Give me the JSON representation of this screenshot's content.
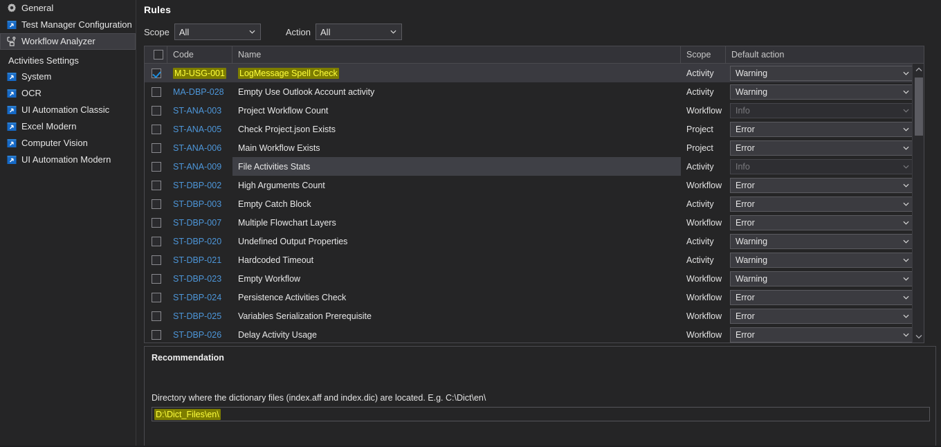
{
  "sidebar": {
    "items": [
      {
        "label": "General",
        "icon": "gear-icon",
        "selected": false,
        "section": false
      },
      {
        "label": "Test Manager Configuration",
        "icon": "package-icon",
        "selected": false,
        "section": false
      },
      {
        "label": "Workflow Analyzer",
        "icon": "workflow-analyzer-icon",
        "selected": true,
        "section": false
      },
      {
        "label": "Activities Settings",
        "icon": "",
        "selected": false,
        "section": true
      },
      {
        "label": "System",
        "icon": "package-icon",
        "selected": false,
        "section": false
      },
      {
        "label": "OCR",
        "icon": "package-icon",
        "selected": false,
        "section": false
      },
      {
        "label": "UI Automation Classic",
        "icon": "package-icon",
        "selected": false,
        "section": false
      },
      {
        "label": "Excel Modern",
        "icon": "package-icon",
        "selected": false,
        "section": false
      },
      {
        "label": "Computer Vision",
        "icon": "package-icon",
        "selected": false,
        "section": false
      },
      {
        "label": "UI Automation Modern",
        "icon": "package-icon",
        "selected": false,
        "section": false
      }
    ]
  },
  "main": {
    "title": "Rules",
    "filters": {
      "scope_label": "Scope",
      "scope_value": "All",
      "action_label": "Action",
      "action_value": "All"
    },
    "table": {
      "headers": {
        "check": "",
        "code": "Code",
        "name": "Name",
        "scope": "Scope",
        "action": "Default action"
      },
      "rows": [
        {
          "checked": true,
          "code": "MJ-USG-001",
          "name": "LogMessage Spell Check",
          "scope": "Activity",
          "action": "Warning",
          "disabled": false,
          "match": true,
          "selected": true,
          "hovered": false
        },
        {
          "checked": false,
          "code": "MA-DBP-028",
          "name": "Empty Use Outlook Account activity",
          "scope": "Activity",
          "action": "Warning",
          "disabled": false,
          "match": false,
          "selected": false,
          "hovered": false
        },
        {
          "checked": false,
          "code": "ST-ANA-003",
          "name": "Project Workflow Count",
          "scope": "Workflow",
          "action": "Info",
          "disabled": true,
          "match": false,
          "selected": false,
          "hovered": false
        },
        {
          "checked": false,
          "code": "ST-ANA-005",
          "name": "Check Project.json Exists",
          "scope": "Project",
          "action": "Error",
          "disabled": false,
          "match": false,
          "selected": false,
          "hovered": false
        },
        {
          "checked": false,
          "code": "ST-ANA-006",
          "name": "Main Workflow Exists",
          "scope": "Project",
          "action": "Error",
          "disabled": false,
          "match": false,
          "selected": false,
          "hovered": false
        },
        {
          "checked": false,
          "code": "ST-ANA-009",
          "name": "File Activities Stats",
          "scope": "Activity",
          "action": "Info",
          "disabled": true,
          "match": false,
          "selected": false,
          "hovered": true
        },
        {
          "checked": false,
          "code": "ST-DBP-002",
          "name": "High Arguments Count",
          "scope": "Workflow",
          "action": "Error",
          "disabled": false,
          "match": false,
          "selected": false,
          "hovered": false
        },
        {
          "checked": false,
          "code": "ST-DBP-003",
          "name": "Empty Catch Block",
          "scope": "Activity",
          "action": "Error",
          "disabled": false,
          "match": false,
          "selected": false,
          "hovered": false
        },
        {
          "checked": false,
          "code": "ST-DBP-007",
          "name": "Multiple Flowchart Layers",
          "scope": "Workflow",
          "action": "Error",
          "disabled": false,
          "match": false,
          "selected": false,
          "hovered": false
        },
        {
          "checked": false,
          "code": "ST-DBP-020",
          "name": "Undefined Output Properties",
          "scope": "Activity",
          "action": "Warning",
          "disabled": false,
          "match": false,
          "selected": false,
          "hovered": false
        },
        {
          "checked": false,
          "code": "ST-DBP-021",
          "name": "Hardcoded Timeout",
          "scope": "Activity",
          "action": "Warning",
          "disabled": false,
          "match": false,
          "selected": false,
          "hovered": false
        },
        {
          "checked": false,
          "code": "ST-DBP-023",
          "name": "Empty Workflow",
          "scope": "Workflow",
          "action": "Warning",
          "disabled": false,
          "match": false,
          "selected": false,
          "hovered": false
        },
        {
          "checked": false,
          "code": "ST-DBP-024",
          "name": "Persistence Activities Check",
          "scope": "Workflow",
          "action": "Error",
          "disabled": false,
          "match": false,
          "selected": false,
          "hovered": false
        },
        {
          "checked": false,
          "code": "ST-DBP-025",
          "name": "Variables Serialization Prerequisite",
          "scope": "Workflow",
          "action": "Error",
          "disabled": false,
          "match": false,
          "selected": false,
          "hovered": false
        },
        {
          "checked": false,
          "code": "ST-DBP-026",
          "name": "Delay Activity Usage",
          "scope": "Workflow",
          "action": "Error",
          "disabled": false,
          "match": false,
          "selected": false,
          "hovered": false
        }
      ]
    },
    "recommendation": {
      "title": "Recommendation",
      "description": "Directory where the dictionary files (index.aff and index.dic) are located. E.g. C:\\Dict\\en\\",
      "input_value": "D:\\Dict_Files\\en\\"
    }
  },
  "colors": {
    "accent_code": "#4d96d9",
    "highlight_bg": "#7d7d00",
    "highlight_fg": "#ffff3c",
    "panel_bg": "#252526",
    "header_bg": "#333338"
  }
}
